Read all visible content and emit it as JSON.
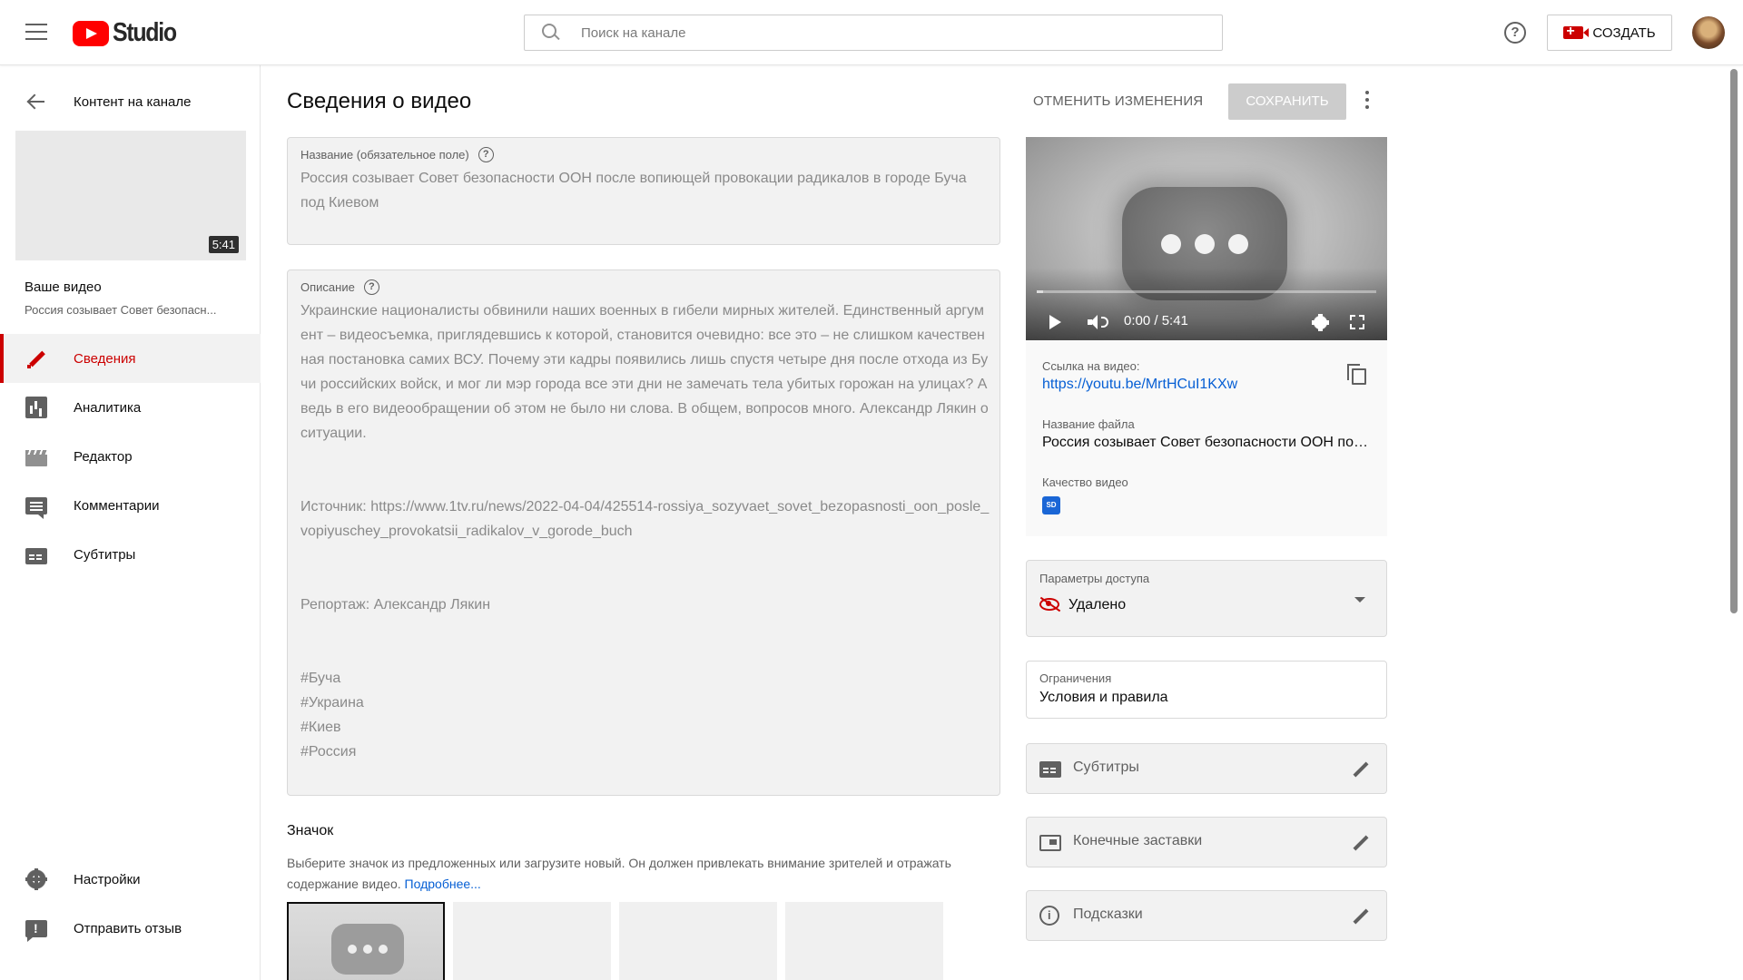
{
  "header": {
    "logo_text": "Studio",
    "search_placeholder": "Поиск на канале",
    "create_label": "СОЗДАТЬ",
    "brand_color": "#ff0000"
  },
  "sidebar": {
    "back_label": "Контент на канале",
    "thumb_duration": "5:41",
    "your_video_label": "Ваше видео",
    "video_title_short": "Россия созывает Совет безопасн...",
    "items": [
      {
        "label": "Сведения",
        "icon": "pencil-icon",
        "active": true
      },
      {
        "label": "Аналитика",
        "icon": "analytics-icon"
      },
      {
        "label": "Редактор",
        "icon": "editor-icon"
      },
      {
        "label": "Комментарии",
        "icon": "comments-icon"
      },
      {
        "label": "Субтитры",
        "icon": "subtitles-icon"
      }
    ],
    "bottom_items": [
      {
        "label": "Настройки",
        "icon": "gear-icon"
      },
      {
        "label": "Отправить отзыв",
        "icon": "feedback-icon"
      }
    ]
  },
  "main": {
    "page_title": "Сведения о видео",
    "undo_label": "ОТМЕНИТЬ ИЗМЕНЕНИЯ",
    "save_label": "СОХРАНИТЬ",
    "title_field": {
      "label": "Название (обязательное поле)",
      "value": "Россия созывает Совет безопасности ООН после вопиющей провокации радикалов в городе Буча под Киевом"
    },
    "description_field": {
      "label": "Описание",
      "value": "Украинские националисты обвинили наших военных в гибели мирных жителей. Единственный аргумент – видеосъемка, приглядевшись к которой, становится очевидно: все это – не слишком качественная постановка самих ВСУ. Почему эти кадры появились лишь спустя четыре дня после отхода из Бучи российских войск, и мог ли мэр города все эти дни не замечать тела убитых горожан на улицах? А ведь в его видеообращении об этом не было ни слова. В общем, вопросов много. Александр Лякин о ситуации.\n\n\nИсточник: https://www.1tv.ru/news/2022-04-04/425514-rossiya_sozyvaet_sovet_bezopasnosti_oon_posle_vopiyuschey_provokatsii_radikalov_v_gorode_buch\n\n\nРепортаж: Александр Лякин\n\n\n#Буча\n#Украина\n#Киев\n#Россия"
    },
    "thumbnail": {
      "title": "Значок",
      "description": "Выберите значок из предложенных или загрузите новый. Он должен привлекать внимание зрителей и отражать содержание видео.",
      "more_link": "Подробнее..."
    }
  },
  "right": {
    "player": {
      "time": "0:00 / 5:41",
      "progress": 0.0
    },
    "video_link_label": "Ссылка на видео:",
    "video_link": "https://youtu.be/MrtHCuI1KXw",
    "file_name_label": "Название файла",
    "file_name": "Россия созывает Совет безопасности ООН после вопиющей провокации",
    "quality_label": "Качество видео",
    "quality_badge": "SD",
    "access": {
      "label": "Параметры доступа",
      "value": "Удалено",
      "status_color": "#cc0000"
    },
    "restrictions": {
      "label": "Ограничения",
      "value": "Условия и правила"
    },
    "features": [
      {
        "label": "Субтитры",
        "icon": "subtitles-icon"
      },
      {
        "label": "Конечные заставки",
        "icon": "end-screen-icon"
      },
      {
        "label": "Подсказки",
        "icon": "info-icon"
      }
    ]
  }
}
